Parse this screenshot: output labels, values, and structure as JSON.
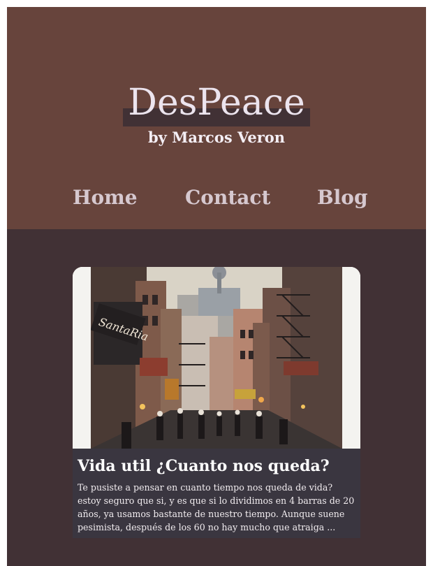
{
  "site": {
    "title": "DesPeace",
    "byline": "by Marcos Veron"
  },
  "nav": {
    "items": [
      {
        "label": "Home"
      },
      {
        "label": "Contact"
      },
      {
        "label": "Blog"
      }
    ]
  },
  "post": {
    "title": "Vida util ¿Cuanto nos queda?",
    "excerpt": "Te pusiste a pensar en cuanto tiempo nos queda de vida?  estoy seguro que si, y es que si lo dividimos en 4 barras de 20 años, ya usamos bastante de nuestro tiempo. Aunque suene pesimista, después de los 60 no hay mucho que atraiga ...",
    "image_sign_text": "SantaRia",
    "image_description": "street-photo"
  },
  "colors": {
    "header_bg": "#67443c",
    "page_bg": "#413135",
    "card_body_bg": "#3a3640",
    "title_text": "#ece4ee",
    "nav_text": "#d6c8cf"
  }
}
